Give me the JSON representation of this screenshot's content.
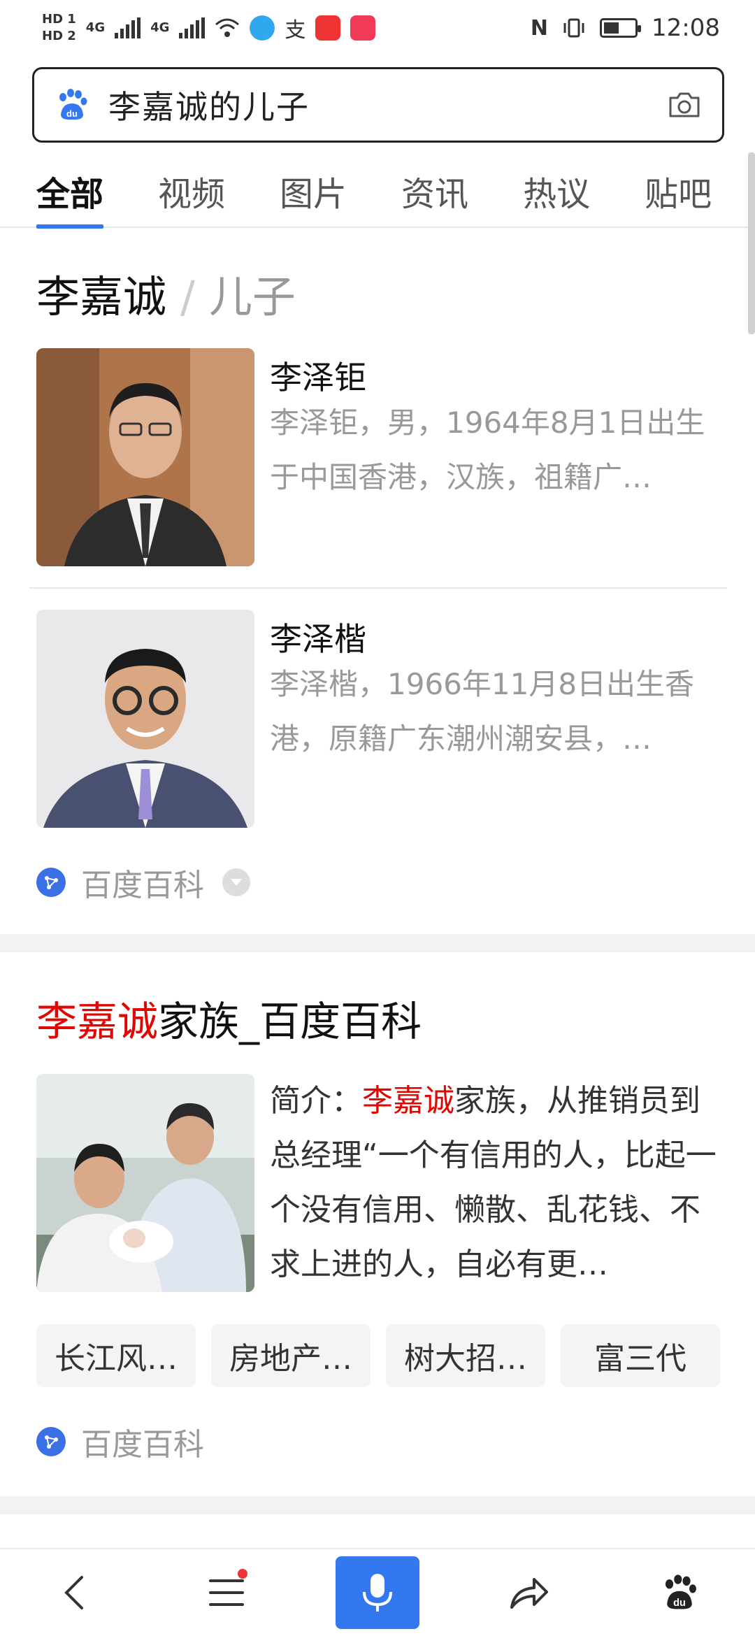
{
  "status_bar": {
    "hd1": "HD 1",
    "hd2": "HD 2",
    "net1": "4G",
    "net2": "4G",
    "time": "12:08",
    "battery_level": 0.5,
    "icons": [
      "signal-icon",
      "wifi-icon",
      "app-icon",
      "alipay-icon",
      "music-app-icon",
      "video-app-icon",
      "nfc-icon",
      "vibrate-icon",
      "battery-icon"
    ]
  },
  "search": {
    "query": "李嘉诚的儿子",
    "logo_icon": "baidu-paw-icon",
    "camera_icon": "camera-icon"
  },
  "tabs": [
    {
      "label": "全部",
      "active": true
    },
    {
      "label": "视频"
    },
    {
      "label": "图片"
    },
    {
      "label": "资讯"
    },
    {
      "label": "热议"
    },
    {
      "label": "贴吧"
    }
  ],
  "knowledge_card": {
    "entity": "李嘉诚",
    "separator": "/",
    "relation": "儿子",
    "people": [
      {
        "name": "李泽钜",
        "desc": "李泽钜，男，1964年8月1日出生于中国香港，汉族，祖籍广…"
      },
      {
        "name": "李泽楷",
        "desc": "李泽楷，1966年11月8日出生香港，原籍广东潮州潮安县，…"
      }
    ],
    "source": "百度百科"
  },
  "result2": {
    "title_highlight": "李嘉诚",
    "title_rest": "家族_百度百科",
    "intro_label": "简介：",
    "intro_highlight": "李嘉诚",
    "intro_rest": "家族，从推销员到总经理“一个有信用的人，比起一个没有信用、懒散、乱花钱、不求上进的人，自必有更…",
    "tags": [
      "长江风…",
      "房地产…",
      "树大招…",
      "富三代"
    ],
    "source": "百度百科"
  },
  "bottom_bar": {
    "icons": [
      "back-icon",
      "menu-icon",
      "mic-icon",
      "share-icon",
      "baidu-home-icon"
    ],
    "accent": "#3478ef"
  },
  "colors": {
    "highlight": "#e10602",
    "accent": "#3478ef"
  }
}
